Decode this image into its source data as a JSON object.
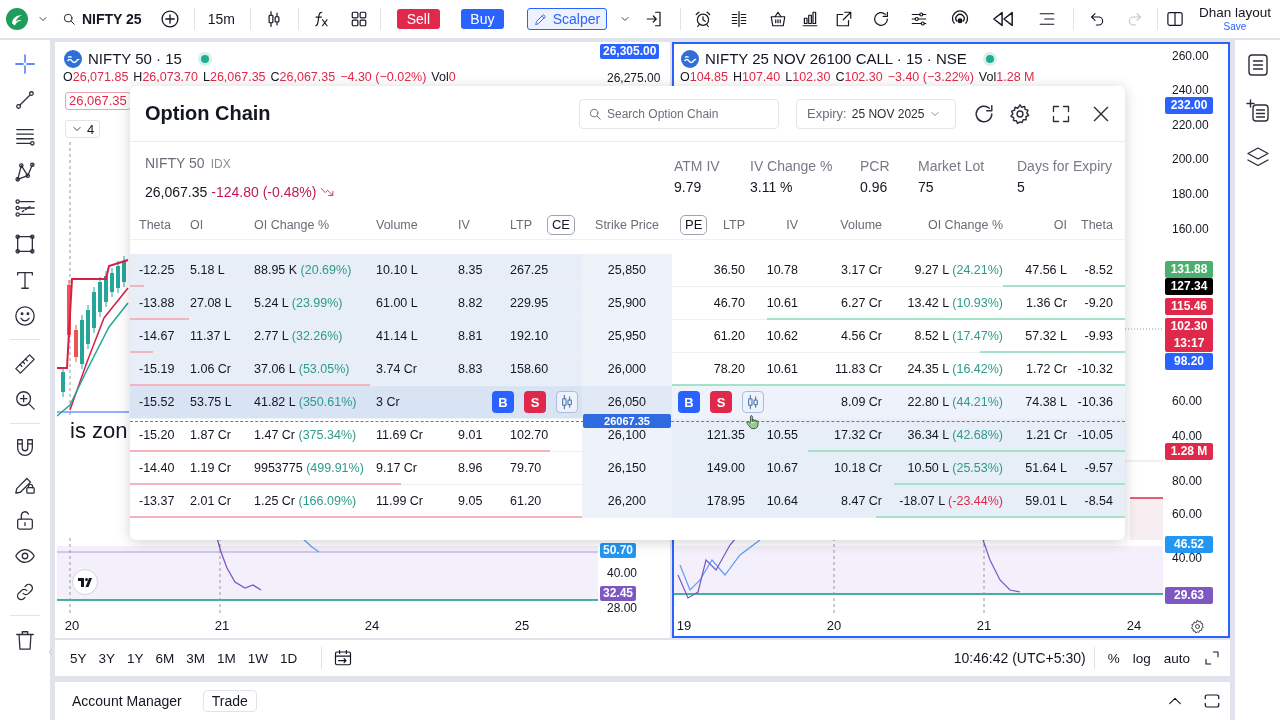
{
  "toolbar": {
    "symbol": "NIFTY 25",
    "interval": "15m",
    "sell": "Sell",
    "buy": "Buy",
    "scalper": "Scalper",
    "undo": {
      "disabled": false
    },
    "redo": {
      "disabled": true
    },
    "layout_name": "Dhan layout",
    "layout_action": "Save"
  },
  "left_tool_groups": [
    [
      {
        "kind": "crosshair",
        "selected": true
      },
      {
        "kind": "trend-line",
        "selected": false
      },
      {
        "kind": "horizontal-lines",
        "selected": false
      },
      {
        "kind": "pattern",
        "selected": false
      },
      {
        "kind": "channel",
        "selected": false
      },
      {
        "kind": "rectangle",
        "selected": false
      },
      {
        "kind": "text",
        "selected": false
      },
      {
        "kind": "emoji",
        "selected": false
      }
    ],
    [
      {
        "kind": "ruler",
        "selected": false
      },
      {
        "kind": "zoom-in",
        "selected": false
      }
    ],
    [
      {
        "kind": "magnet",
        "selected": false
      },
      {
        "kind": "drawing-lock",
        "selected": false
      },
      {
        "kind": "lock",
        "selected": false
      },
      {
        "kind": "eye",
        "selected": false
      },
      {
        "kind": "link",
        "selected": false
      }
    ],
    [
      {
        "kind": "trash",
        "selected": false
      }
    ]
  ],
  "charts": [
    {
      "selected": false,
      "title": "NIFTY 50 · 15",
      "falling": true,
      "ohlc": [
        {
          "label": "O",
          "value": "26,071.85"
        },
        {
          "label": "H",
          "value": "26,073.70"
        },
        {
          "label": "L",
          "value": "26,067.35"
        },
        {
          "label": "C",
          "value": "26,067.35"
        }
      ],
      "change": "−4.30 (−0.02%)",
      "volume": {
        "label": "Vol",
        "value": "0"
      },
      "price_label": "26,067.35",
      "indicators_toggle": "4",
      "drawing_text": "is zon",
      "price_axis": [
        {
          "kind": "tag",
          "text": "26,305.00",
          "color": "#2962ff"
        },
        {
          "kind": "tick",
          "text": "26,275.00"
        },
        {
          "kind": "tag",
          "text": "50.70",
          "color": "#2196f3"
        },
        {
          "kind": "tick",
          "text": "40.00"
        },
        {
          "kind": "tag",
          "text": "32.45",
          "color": "#7e57c2"
        },
        {
          "kind": "tick",
          "text": "28.00"
        }
      ],
      "time_axis": [
        "20",
        "21",
        "24",
        "25"
      ]
    },
    {
      "selected": true,
      "title": "NIFTY 25 NOV 26100 CALL · 15 · NSE",
      "falling": true,
      "ohlc": [
        {
          "label": "O",
          "value": "104.85"
        },
        {
          "label": "H",
          "value": "107.40"
        },
        {
          "label": "L",
          "value": "102.30"
        },
        {
          "label": "C",
          "value": "102.30"
        }
      ],
      "change": "−3.40 (−3.22%)",
      "volume": {
        "label": "Vol",
        "value": "1.28 M"
      },
      "price_axis": [
        {
          "kind": "tick",
          "text": "260.00"
        },
        {
          "kind": "tick",
          "text": "240.00"
        },
        {
          "kind": "tag",
          "text": "232.00",
          "color": "#2962ff"
        },
        {
          "kind": "tick",
          "text": "220.00"
        },
        {
          "kind": "tick",
          "text": "200.00"
        },
        {
          "kind": "tick",
          "text": "180.00"
        },
        {
          "kind": "tick",
          "text": "160.00"
        },
        {
          "kind": "tag",
          "text": "131.88",
          "color": "#4caf70"
        },
        {
          "kind": "tag",
          "text": "127.34",
          "color": "#000000"
        },
        {
          "kind": "tag",
          "text": "115.46",
          "color": "#e0294a"
        },
        {
          "kind": "tag",
          "text": "102.30",
          "subtext": "13:17",
          "color": "#e0294a"
        },
        {
          "kind": "tag",
          "text": "98.20",
          "color": "#2962ff"
        },
        {
          "kind": "tick",
          "text": "60.00"
        },
        {
          "kind": "tick",
          "text": "40.00"
        },
        {
          "kind": "tag",
          "text": "1.28 M",
          "color": "#e0294a"
        },
        {
          "kind": "tick",
          "text": "80.00"
        },
        {
          "kind": "tick",
          "text": "60.00"
        },
        {
          "kind": "tag",
          "text": "46.52",
          "color": "#2196f3"
        },
        {
          "kind": "tick",
          "text": "40.00"
        },
        {
          "kind": "tag",
          "text": "29.63",
          "color": "#7e57c2"
        }
      ],
      "time_axis": [
        "19",
        "20",
        "21",
        "24"
      ]
    }
  ],
  "range_bar": {
    "ranges": [
      "5Y",
      "3Y",
      "1Y",
      "6M",
      "3M",
      "1M",
      "1W",
      "1D"
    ],
    "clock": "10:46:42 (UTC+5:30)",
    "scale_options": [
      "%",
      "log",
      "auto"
    ]
  },
  "bottom_panel": {
    "title": "Account Manager",
    "tab": "Trade"
  },
  "option_chain": {
    "title": "Option Chain",
    "search": {
      "placeholder": "Search Option Chain"
    },
    "expiry": {
      "label": "Expiry:",
      "value": "25 NOV 2025"
    },
    "underlying": {
      "name": "NIFTY 50",
      "type": "IDX",
      "price": "26,067.35",
      "change": "-124.80 (-0.48%)",
      "falling": true
    },
    "stats": [
      {
        "label": "ATM IV",
        "value": "9.79"
      },
      {
        "label": "IV Change %",
        "value": "3.11 %"
      },
      {
        "label": "PCR",
        "value": "0.96"
      },
      {
        "label": "Market Lot",
        "value": "75"
      },
      {
        "label": "Days for Expiry",
        "value": "5"
      }
    ],
    "call_columns": [
      "Theta",
      "OI",
      "OI Change %",
      "Volume",
      "IV",
      "LTP"
    ],
    "call_badge": "CE",
    "strike_column": "Strike Price",
    "put_badge": "PE",
    "put_columns": [
      "LTP",
      "IV",
      "Volume",
      "OI Change %",
      "OI",
      "Theta"
    ],
    "rows": [
      {
        "strike": "25,850",
        "hovered": false,
        "spot_line_below": false,
        "call": {
          "itm": true,
          "theta": "-12.25",
          "oi": "5.18 L",
          "oi_change": "88.95 K",
          "oi_change_pct": "(20.69%)",
          "negative": false,
          "volume": "10.10 L",
          "iv": "8.35",
          "ltp": "267.25",
          "oi_bar": {
            "level": 0.03
          }
        },
        "put": {
          "itm": false,
          "ltp": "36.50",
          "iv": "10.78",
          "volume": "3.17 Cr",
          "oi_change": "9.27 L",
          "oi_change_pct": "(24.21%)",
          "negative": false,
          "oi": "47.56 L",
          "theta": "-8.52",
          "oi_bar": {
            "level": 0.27
          }
        }
      },
      {
        "strike": "25,900",
        "hovered": false,
        "spot_line_below": false,
        "call": {
          "itm": true,
          "theta": "-13.88",
          "oi": "27.08 L",
          "oi_change": "5.24 L",
          "oi_change_pct": "(23.99%)",
          "negative": false,
          "volume": "61.00 L",
          "iv": "8.82",
          "ltp": "229.95",
          "oi_bar": {
            "level": 0.13
          }
        },
        "put": {
          "itm": false,
          "ltp": "46.70",
          "iv": "10.61",
          "volume": "6.27 Cr",
          "oi_change": "13.42 L",
          "oi_change_pct": "(10.93%)",
          "negative": false,
          "oi": "1.36 Cr",
          "theta": "-9.20",
          "oi_bar": {
            "level": 0.79
          }
        }
      },
      {
        "strike": "25,950",
        "hovered": false,
        "spot_line_below": false,
        "call": {
          "itm": true,
          "theta": "-14.67",
          "oi": "11.37 L",
          "oi_change": "2.77 L",
          "oi_change_pct": "(32.26%)",
          "negative": false,
          "volume": "41.14 L",
          "iv": "8.81",
          "ltp": "192.10",
          "oi_bar": {
            "level": 0.05
          }
        },
        "put": {
          "itm": false,
          "ltp": "61.20",
          "iv": "10.62",
          "volume": "4.56 Cr",
          "oi_change": "8.52 L",
          "oi_change_pct": "(17.47%)",
          "negative": false,
          "oi": "57.32 L",
          "theta": "-9.93",
          "oi_bar": {
            "level": 0.32
          }
        }
      },
      {
        "strike": "26,000",
        "hovered": false,
        "spot_line_below": false,
        "call": {
          "itm": true,
          "theta": "-15.19",
          "oi": "1.06 Cr",
          "oi_change": "37.06 L",
          "oi_change_pct": "(53.05%)",
          "negative": false,
          "volume": "3.74 Cr",
          "iv": "8.83",
          "ltp": "158.60",
          "oi_bar": {
            "level": 0.53
          }
        },
        "put": {
          "itm": false,
          "ltp": "78.20",
          "iv": "10.61",
          "volume": "11.83 Cr",
          "oi_change": "24.35 L",
          "oi_change_pct": "(16.42%)",
          "negative": false,
          "oi": "1.72 Cr",
          "theta": "-10.32",
          "oi_bar": {
            "level": 1
          }
        }
      },
      {
        "strike": "26,050",
        "hovered": true,
        "spot_line_below": true,
        "call": {
          "itm": true,
          "theta": "-15.52",
          "oi": "53.75 L",
          "oi_change": "41.82 L",
          "oi_change_pct": "(350.61%)",
          "negative": false,
          "volume": "3 Cr",
          "actions": [
            {
              "kind": "buy",
              "label": "B"
            },
            {
              "kind": "sell",
              "label": "S"
            },
            {
              "kind": "chart"
            }
          ]
        },
        "put": {
          "itm": false,
          "actions": [
            {
              "kind": "buy",
              "label": "B"
            },
            {
              "kind": "sell",
              "label": "S"
            },
            {
              "kind": "chart"
            }
          ],
          "volume": "8.09 Cr",
          "oi_change": "22.80 L",
          "oi_change_pct": "(44.21%)",
          "negative": false,
          "oi": "74.38 L",
          "theta": "-10.36"
        }
      },
      {
        "strike": "26,100",
        "hovered": false,
        "spot_line_below": false,
        "call": {
          "itm": false,
          "theta": "-15.20",
          "oi": "1.87 Cr",
          "oi_change": "1.47 Cr",
          "oi_change_pct": "(375.34%)",
          "negative": false,
          "volume": "11.69 Cr",
          "iv": "9.01",
          "ltp": "102.70",
          "oi_bar": {
            "level": 0.93
          }
        },
        "put": {
          "itm": true,
          "ltp": "121.35",
          "iv": "10.55",
          "volume": "17.32 Cr",
          "oi_change": "36.34 L",
          "oi_change_pct": "(42.68%)",
          "negative": false,
          "oi": "1.21 Cr",
          "theta": "-10.05",
          "oi_bar": {
            "level": 0.7
          }
        }
      },
      {
        "strike": "26,150",
        "hovered": false,
        "spot_line_below": false,
        "call": {
          "itm": false,
          "theta": "-14.40",
          "oi": "1.19 Cr",
          "oi_change": "9953775",
          "oi_change_pct": "(499.91%)",
          "negative": false,
          "volume": "9.17 Cr",
          "iv": "8.96",
          "ltp": "79.70",
          "oi_bar": {
            "level": 0.6
          }
        },
        "put": {
          "itm": true,
          "ltp": "149.00",
          "iv": "10.67",
          "volume": "10.18 Cr",
          "oi_change": "10.50 L",
          "oi_change_pct": "(25.53%)",
          "negative": false,
          "oi": "51.64 L",
          "theta": "-9.57",
          "oi_bar": {
            "level": 0.51
          }
        }
      },
      {
        "strike": "26,200",
        "hovered": false,
        "spot_line_below": false,
        "call": {
          "itm": false,
          "theta": "-13.37",
          "oi": "2.01 Cr",
          "oi_change": "1.25 Cr",
          "oi_change_pct": "(166.09%)",
          "negative": false,
          "volume": "11.99 Cr",
          "iv": "9.05",
          "ltp": "61.20",
          "oi_bar": {
            "level": 1
          }
        },
        "put": {
          "itm": true,
          "ltp": "178.95",
          "iv": "10.64",
          "volume": "8.47 Cr",
          "oi_change": "-18.07 L",
          "oi_change_pct": "(-23.44%)",
          "negative": true,
          "oi": "59.01 L",
          "theta": "-8.54",
          "oi_bar": {
            "level": 0.55
          }
        }
      }
    ],
    "spot_label": "26067.35"
  }
}
